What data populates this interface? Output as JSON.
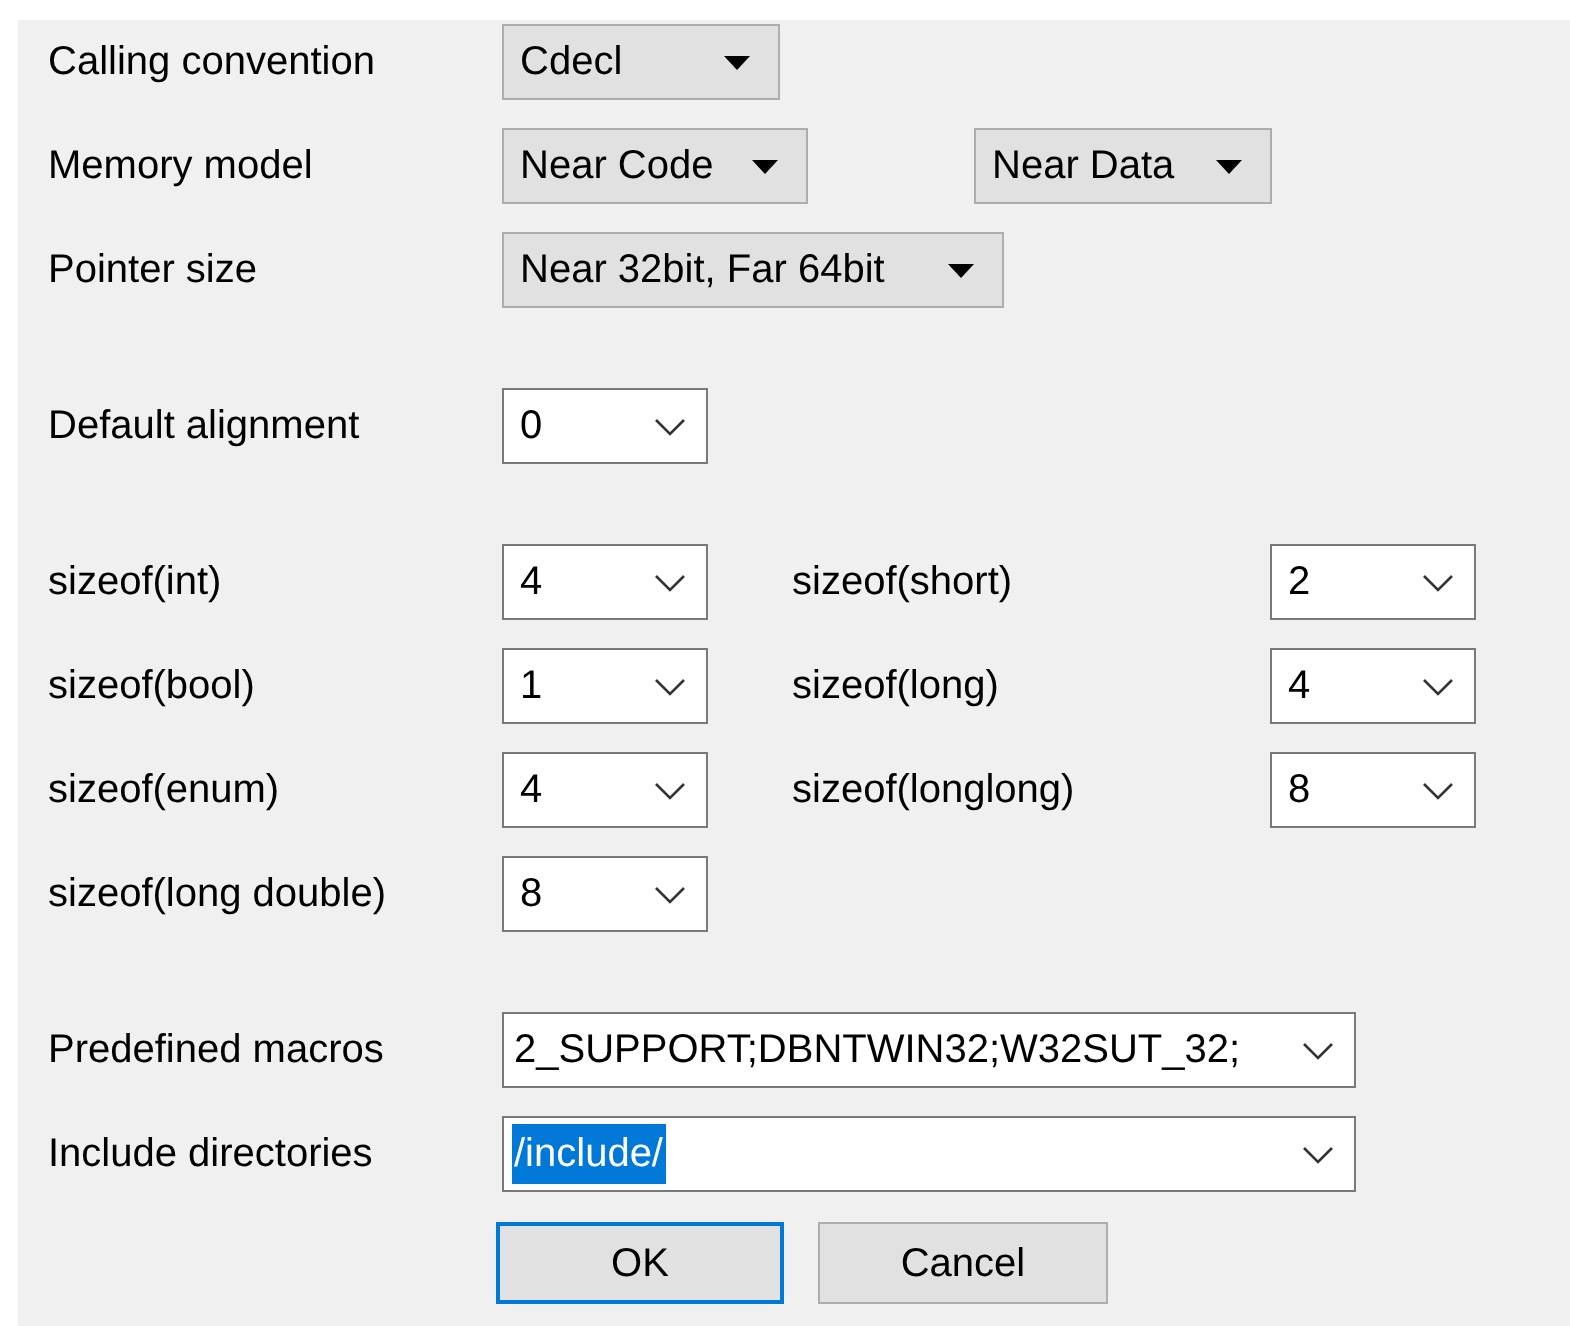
{
  "sections": [
    {
      "rows": [
        {
          "items": [
            {
              "label": "Calling convention",
              "controls": [
                {
                  "kind": "dropdown",
                  "value": "Cdecl"
                }
              ]
            }
          ]
        },
        {
          "items": [
            {
              "label": "Memory model",
              "controls": [
                {
                  "kind": "dropdown",
                  "value": "Near Code"
                },
                {
                  "kind": "dropdown",
                  "value": "Near Data"
                }
              ]
            }
          ]
        },
        {
          "items": [
            {
              "label": "Pointer size",
              "controls": [
                {
                  "kind": "dropdown",
                  "value": "Near 32bit, Far 64bit"
                }
              ]
            }
          ]
        }
      ]
    },
    {
      "rows": [
        {
          "items": [
            {
              "label": "Default alignment",
              "controls": [
                {
                  "kind": "combo",
                  "value": "0"
                }
              ]
            }
          ]
        }
      ]
    },
    {
      "rows": [
        {
          "items": [
            {
              "label": "sizeof(int)",
              "controls": [
                {
                  "kind": "combo",
                  "value": "4"
                }
              ]
            },
            {
              "label": "sizeof(short)",
              "controls": [
                {
                  "kind": "combo",
                  "value": "2"
                }
              ]
            }
          ]
        },
        {
          "items": [
            {
              "label": "sizeof(bool)",
              "controls": [
                {
                  "kind": "combo",
                  "value": "1"
                }
              ]
            },
            {
              "label": "sizeof(long)",
              "controls": [
                {
                  "kind": "combo",
                  "value": "4"
                }
              ]
            }
          ]
        },
        {
          "items": [
            {
              "label": "sizeof(enum)",
              "controls": [
                {
                  "kind": "combo",
                  "value": "4"
                }
              ]
            },
            {
              "label": "sizeof(longlong)",
              "controls": [
                {
                  "kind": "combo",
                  "value": "8"
                }
              ]
            }
          ]
        },
        {
          "items": [
            {
              "label": "sizeof(long double)",
              "controls": [
                {
                  "kind": "combo",
                  "value": "8"
                }
              ]
            }
          ]
        }
      ]
    },
    {
      "rows": [
        {
          "items": [
            {
              "label": "Predefined macros",
              "controls": [
                {
                  "kind": "wide_combo",
                  "value": "2_SUPPORT;DBNTWIN32;W32SUT_32;",
                  "text_selected": false
                }
              ]
            }
          ]
        },
        {
          "items": [
            {
              "label": "Include directories",
              "controls": [
                {
                  "kind": "wide_combo",
                  "value": "/include/",
                  "text_selected": true
                }
              ]
            }
          ]
        }
      ]
    }
  ],
  "buttons": [
    {
      "label": "OK",
      "default": true
    },
    {
      "label": "Cancel",
      "default": false
    }
  ]
}
